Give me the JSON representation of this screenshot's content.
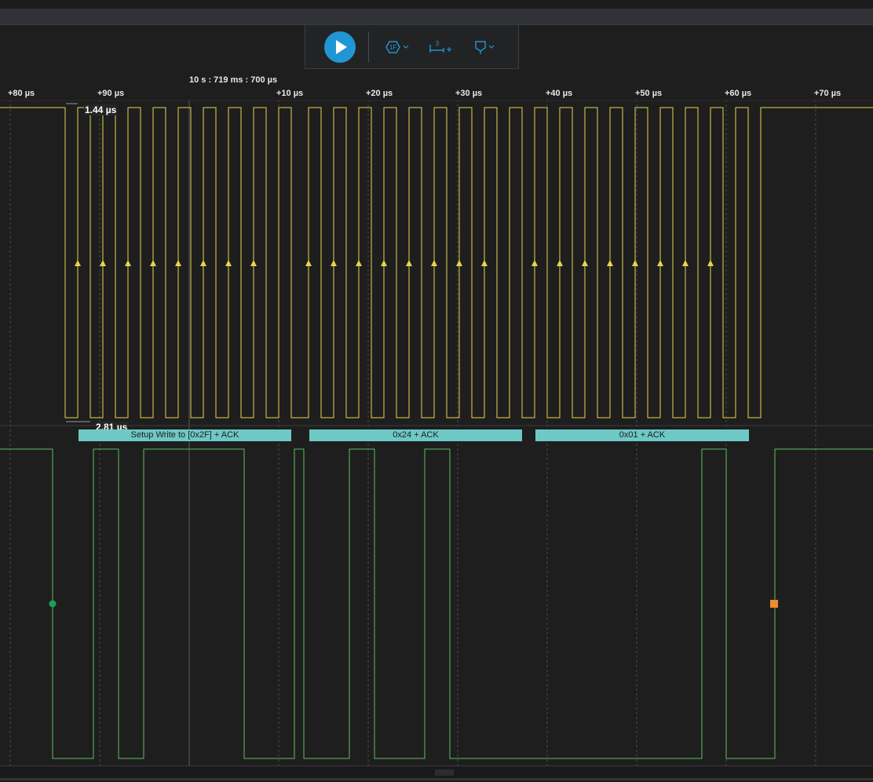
{
  "toolbar": {
    "play_icon": "play-icon",
    "trigger_icon": "trigger-1f-icon",
    "trigger_label": "1F",
    "measure_icon": "measurement-add-icon",
    "measure_label": "3",
    "marker_icon": "marker-filter-icon",
    "accent": "#2196d4"
  },
  "ruler": {
    "anchor_time": "10 s : 719 ms : 700 µs",
    "ticks": [
      "+80 µs",
      "+90 µs",
      "+10 µs",
      "+20 µs",
      "+30 µs",
      "+40 µs",
      "+50 µs",
      "+60 µs",
      "+70 µs"
    ]
  },
  "measurements": {
    "pulse_width": "1.44 µs",
    "period": "2.81 µs"
  },
  "decoder": {
    "frames": [
      "Setup Write to [0x2F] + ACK",
      "0x24 + ACK",
      "0x01 + ACK"
    ],
    "color": "#6dc9c6"
  },
  "channels": {
    "clock_color": "#e8d44d",
    "data_color": "#5fbf5f",
    "start_marker_color": "#17a05a",
    "stop_marker_color": "#f08a30"
  }
}
